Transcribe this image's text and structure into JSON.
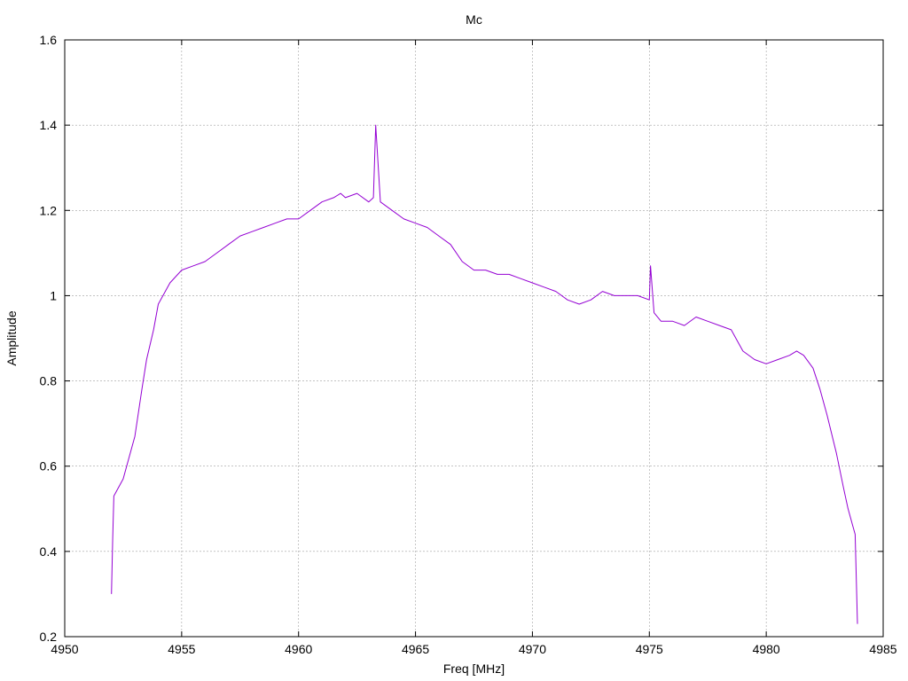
{
  "chart_data": {
    "type": "line",
    "title": "Mc",
    "xlabel": "Freq [MHz]",
    "ylabel": "Amplitude",
    "xlim": [
      4950,
      4985
    ],
    "ylim": [
      0.2,
      1.6
    ],
    "xticks": [
      4950,
      4955,
      4960,
      4965,
      4970,
      4975,
      4980,
      4985
    ],
    "xtick_labels": [
      "4950",
      "4955",
      "4960",
      "4965",
      "4970",
      "4975",
      "4980",
      "4985"
    ],
    "yticks": [
      0.2,
      0.4,
      0.6,
      0.8,
      1.0,
      1.2,
      1.4,
      1.6
    ],
    "ytick_labels": [
      "0.2",
      "0.4",
      "0.6",
      "0.8",
      "1",
      "1.2",
      "1.4",
      "1.6"
    ],
    "grid": true,
    "series": [
      {
        "color": "#9400d3",
        "x": [
          4952.0,
          4952.05,
          4952.1,
          4952.5,
          4953.0,
          4953.3,
          4953.5,
          4953.8,
          4954.0,
          4954.5,
          4955.0,
          4955.5,
          4956.0,
          4956.5,
          4957.0,
          4957.5,
          4958.0,
          4958.5,
          4959.0,
          4959.5,
          4960.0,
          4960.5,
          4961.0,
          4961.5,
          4961.8,
          4962.0,
          4962.5,
          4963.0,
          4963.2,
          4963.3,
          4963.5,
          4964.0,
          4964.5,
          4965.0,
          4965.5,
          4966.0,
          4966.5,
          4967.0,
          4967.5,
          4968.0,
          4968.5,
          4969.0,
          4969.5,
          4970.0,
          4970.5,
          4971.0,
          4971.5,
          4972.0,
          4972.5,
          4973.0,
          4973.5,
          4974.0,
          4974.5,
          4975.0,
          4975.05,
          4975.2,
          4975.5,
          4976.0,
          4976.5,
          4977.0,
          4977.5,
          4978.0,
          4978.5,
          4979.0,
          4979.5,
          4980.0,
          4980.5,
          4981.0,
          4981.3,
          4981.6,
          4982.0,
          4982.3,
          4982.6,
          4983.0,
          4983.3,
          4983.5,
          4983.7,
          4983.8,
          4983.9
        ],
        "y": [
          0.3,
          0.43,
          0.53,
          0.57,
          0.67,
          0.78,
          0.85,
          0.92,
          0.98,
          1.03,
          1.06,
          1.07,
          1.08,
          1.1,
          1.12,
          1.14,
          1.15,
          1.16,
          1.17,
          1.18,
          1.18,
          1.2,
          1.22,
          1.23,
          1.24,
          1.23,
          1.24,
          1.22,
          1.23,
          1.4,
          1.22,
          1.2,
          1.18,
          1.17,
          1.16,
          1.14,
          1.12,
          1.08,
          1.06,
          1.06,
          1.05,
          1.05,
          1.04,
          1.03,
          1.02,
          1.01,
          0.99,
          0.98,
          0.99,
          1.01,
          1.0,
          1.0,
          1.0,
          0.99,
          1.07,
          0.96,
          0.94,
          0.94,
          0.93,
          0.95,
          0.94,
          0.93,
          0.92,
          0.87,
          0.85,
          0.84,
          0.85,
          0.86,
          0.87,
          0.86,
          0.83,
          0.78,
          0.72,
          0.63,
          0.55,
          0.5,
          0.46,
          0.44,
          0.23
        ]
      }
    ]
  }
}
